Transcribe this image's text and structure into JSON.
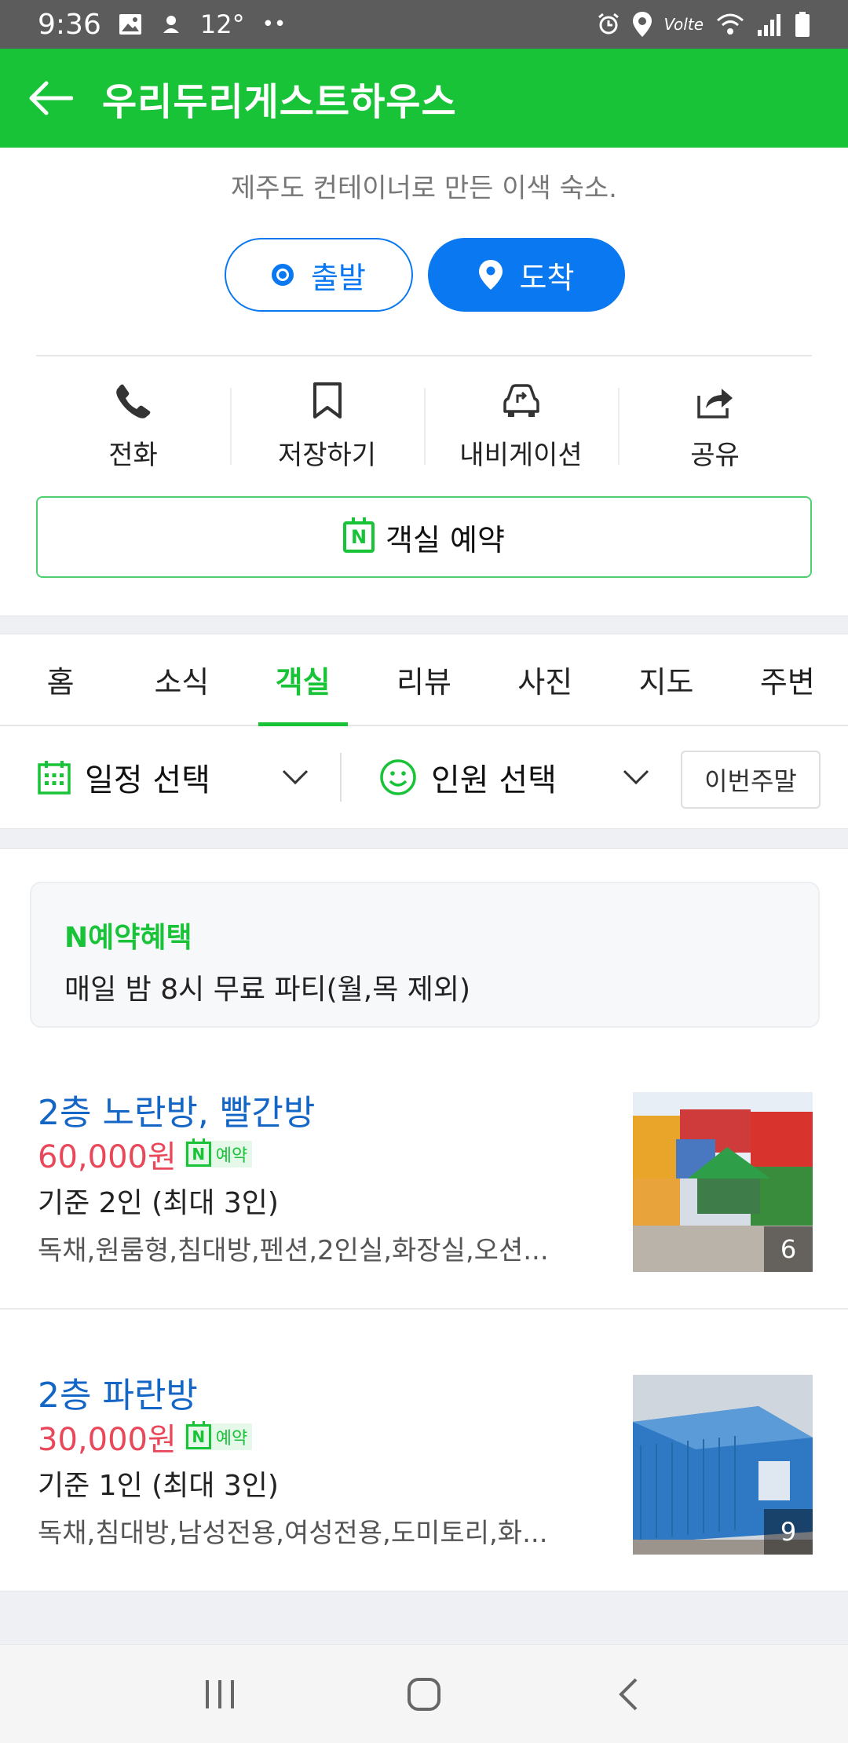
{
  "status_bar": {
    "time": "9:36",
    "temperature": "12°",
    "extra": "••",
    "network": "Volte"
  },
  "header": {
    "title": "우리두리게스트하우스"
  },
  "place": {
    "description": "제주도 컨테이너로 만든 이색 숙소."
  },
  "route": {
    "start_label": "출발",
    "end_label": "도착"
  },
  "actions": {
    "call_label": "전화",
    "save_label": "저장하기",
    "navigation_label": "내비게이션",
    "share_label": "공유"
  },
  "reserve": {
    "label": "객실 예약",
    "badge": "N"
  },
  "tabs": [
    "홈",
    "소식",
    "객실",
    "리뷰",
    "사진",
    "지도",
    "주변"
  ],
  "active_tab": "객실",
  "filters": {
    "date_label": "일정 선택",
    "people_label": "인원 선택",
    "weekend_label": "이번주말"
  },
  "benefit": {
    "title": "N예약혜택",
    "detail": "매일 밤 8시 무료 파티(월,목 제외)"
  },
  "rooms": [
    {
      "name": "2층 노란방, 빨간방",
      "price": "60,000원",
      "badge": "예약",
      "capacity": "기준 2인 (최대 3인)",
      "tags": "독채,원룸형,침대방,펜션,2인실,화장실,오션...",
      "photo_count": "6"
    },
    {
      "name": "2층 파란방",
      "price": "30,000원",
      "badge": "예약",
      "capacity": "기준 1인 (최대 3인)",
      "tags": "독채,침대방,남성전용,여성전용,도미토리,화...",
      "photo_count": "9"
    }
  ],
  "colors": {
    "brand_green": "#19c337",
    "blue": "#0a78f0",
    "price_red": "#e9485a",
    "name_blue": "#1466c6"
  }
}
